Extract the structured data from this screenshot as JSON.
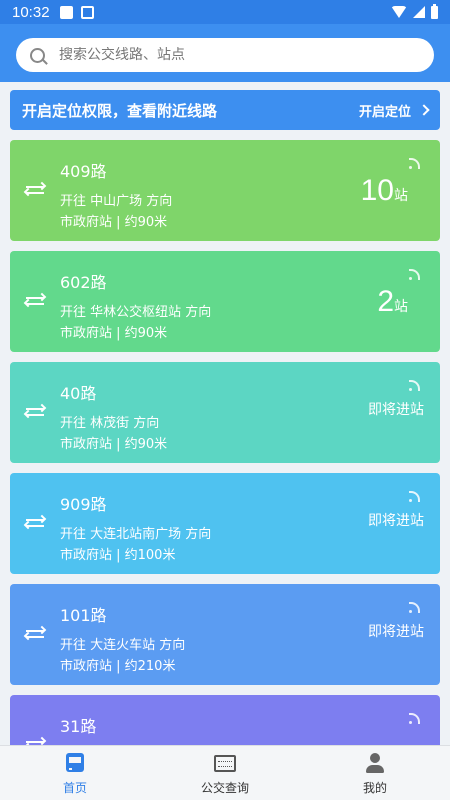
{
  "status_bar": {
    "time": "10:32"
  },
  "search": {
    "placeholder": "搜索公交线路、站点"
  },
  "location_banner": {
    "message": "开启定位权限，查看附近线路",
    "action": "开启定位"
  },
  "lines": [
    {
      "route": "409路",
      "direction": "开往 中山广场 方向",
      "stop": "市政府站 | 约90米",
      "arrival_num": "10",
      "arrival_unit": "站",
      "arrival_text": "",
      "color": "#7fd56a"
    },
    {
      "route": "602路",
      "direction": "开往 华林公交枢纽站 方向",
      "stop": "市政府站 | 约90米",
      "arrival_num": "2",
      "arrival_unit": "站",
      "arrival_text": "",
      "color": "#62d98c"
    },
    {
      "route": "40路",
      "direction": "开往 林茂街 方向",
      "stop": "市政府站 | 约90米",
      "arrival_num": "",
      "arrival_unit": "",
      "arrival_text": "即将进站",
      "color": "#5cd6c3"
    },
    {
      "route": "909路",
      "direction": "开往 大连北站南广场 方向",
      "stop": "市政府站 | 约100米",
      "arrival_num": "",
      "arrival_unit": "",
      "arrival_text": "即将进站",
      "color": "#4fc2f0"
    },
    {
      "route": "101路",
      "direction": "开往 大连火车站 方向",
      "stop": "市政府站 | 约210米",
      "arrival_num": "",
      "arrival_unit": "",
      "arrival_text": "即将进站",
      "color": "#5b9cf2"
    },
    {
      "route": "31路",
      "direction": "",
      "stop": "",
      "arrival_num": "",
      "arrival_unit": "",
      "arrival_text": "",
      "color": "#7d7ef0"
    }
  ],
  "tabs": [
    {
      "label": "首页",
      "icon": "bus-icon",
      "active": true
    },
    {
      "label": "公交查询",
      "icon": "screen-icon",
      "active": false
    },
    {
      "label": "我的",
      "icon": "user-icon",
      "active": false
    }
  ]
}
